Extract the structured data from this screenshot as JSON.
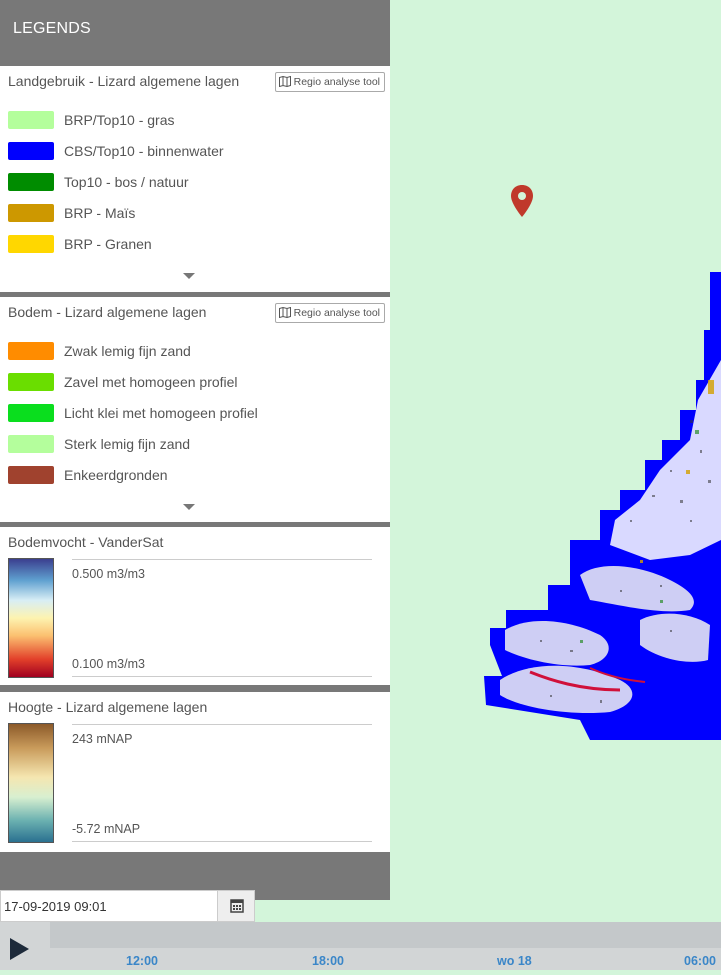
{
  "panel": {
    "title": "LEGENDS",
    "sections": [
      {
        "title": "Landgebruik - Lizard algemene lagen",
        "tool_button": "Regio analyse tool",
        "items": [
          {
            "label": "BRP/Top10 - gras",
            "color": "#b4fe9c"
          },
          {
            "label": "CBS/Top10 - binnenwater",
            "color": "#0000fe"
          },
          {
            "label": "Top10 - bos / natuur",
            "color": "#008c00"
          },
          {
            "label": "BRP - Maïs",
            "color": "#cd9800"
          },
          {
            "label": "BRP - Granen",
            "color": "#ffd700"
          }
        ]
      },
      {
        "title": "Bodem - Lizard algemene lagen",
        "tool_button": "Regio analyse tool",
        "items": [
          {
            "label": "Zwak lemig fijn zand",
            "color": "#ff8c00"
          },
          {
            "label": "Zavel met homogeen profiel",
            "color": "#6ade00"
          },
          {
            "label": "Licht klei met homogeen profiel",
            "color": "#0ade1e"
          },
          {
            "label": "Sterk lemig fijn zand",
            "color": "#b4fe9c"
          },
          {
            "label": "Enkeerdgronden",
            "color": "#a0422e"
          }
        ]
      },
      {
        "title": "Bodemvocht - VanderSat",
        "max_label": "0.500 m3/m3",
        "min_label": "0.100 m3/m3"
      },
      {
        "title": "Hoogte - Lizard algemene lagen",
        "max_label": "243 mNAP",
        "min_label": "-5.72 mNAP"
      }
    ]
  },
  "date_field": {
    "value": "17-09-2019 09:01",
    "icon": "calendar-icon"
  },
  "timeline": {
    "play_icon": "play-icon",
    "ticks": [
      "12:00",
      "18:00",
      "wo 18",
      "06:00"
    ]
  },
  "map": {
    "pin_icon": "map-marker-icon",
    "colors": {
      "background": "#d3f5da",
      "water": "#0000fe",
      "pin": "#c0392b"
    }
  }
}
